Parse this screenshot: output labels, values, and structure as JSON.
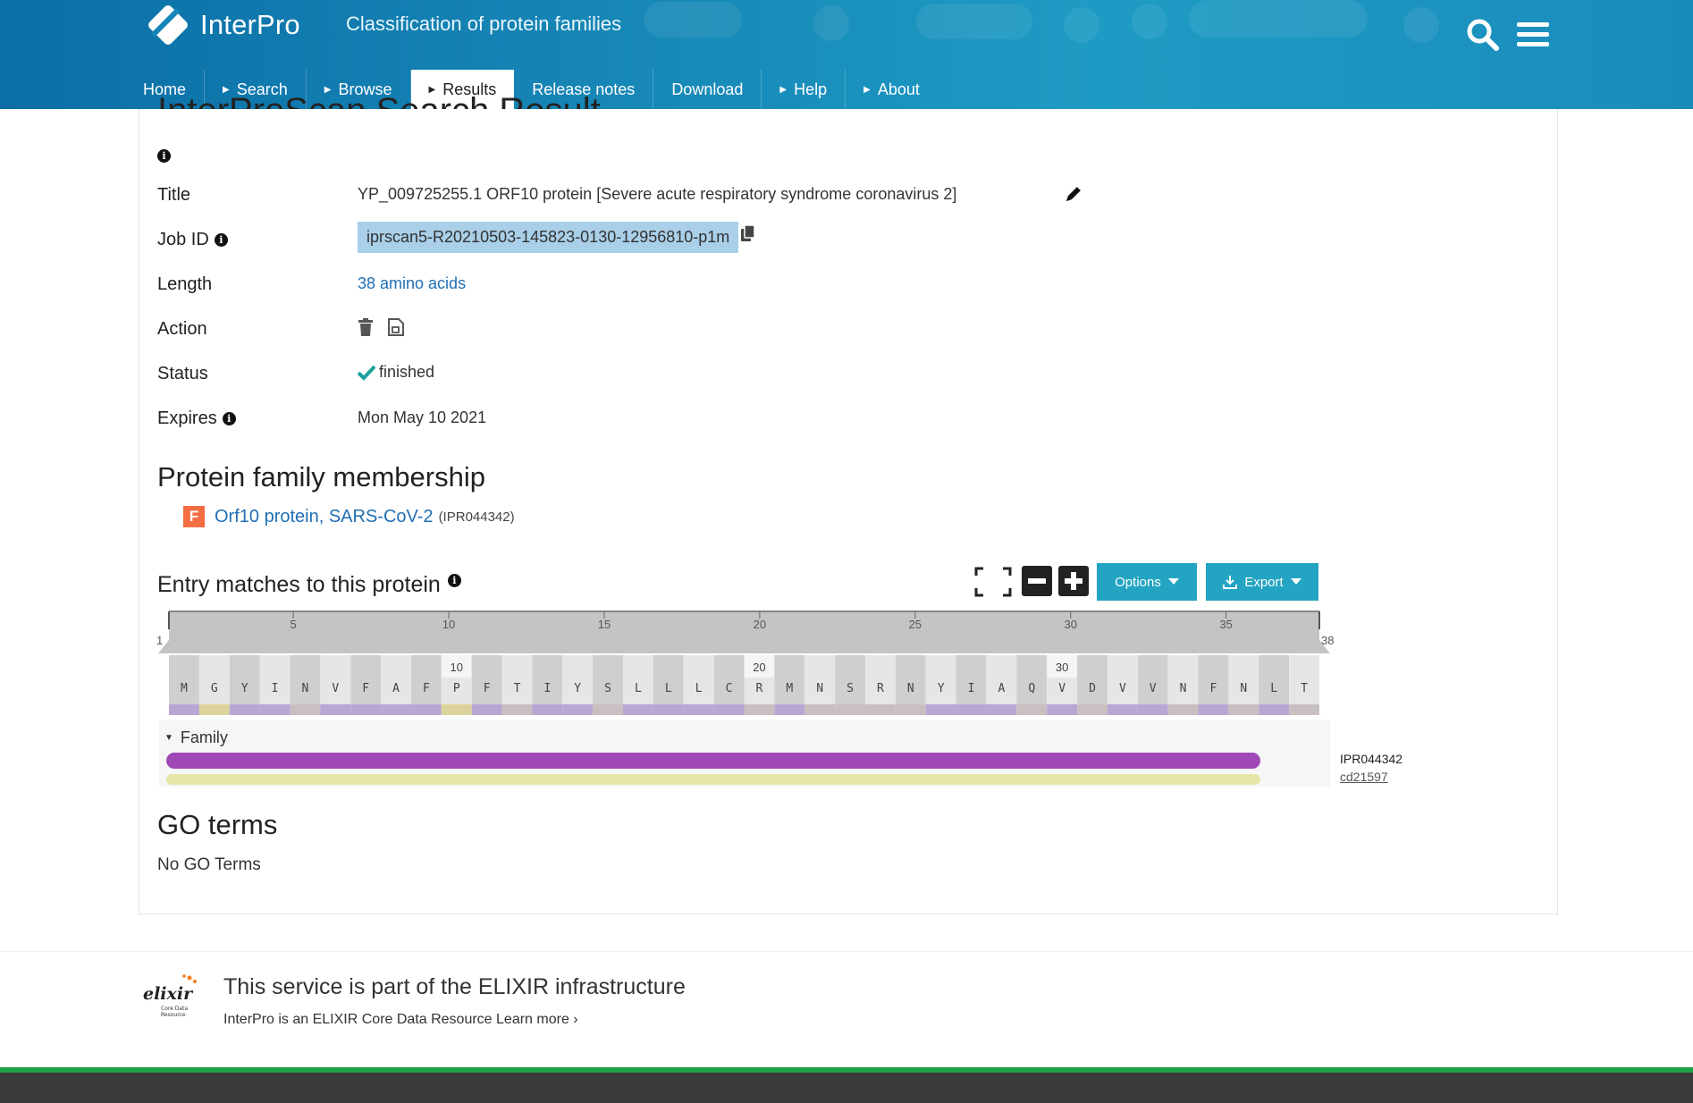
{
  "header": {
    "logo_text": "InterPro",
    "tagline": "Classification of protein families",
    "nav": [
      {
        "label": "Home",
        "arrow": false
      },
      {
        "label": "Search",
        "arrow": true
      },
      {
        "label": "Browse",
        "arrow": true
      },
      {
        "label": "Results",
        "arrow": true,
        "active": true
      },
      {
        "label": "Release notes",
        "arrow": false
      },
      {
        "label": "Download",
        "arrow": false
      },
      {
        "label": "Help",
        "arrow": true
      },
      {
        "label": "About",
        "arrow": true
      }
    ]
  },
  "page": {
    "title": "InterProScan Search Result"
  },
  "details": {
    "title_label": "Title",
    "title_value": "YP_009725255.1 ORF10 protein [Severe acute respiratory syndrome coronavirus 2]",
    "jobid_label": "Job ID",
    "jobid_value": "iprscan5-R20210503-145823-0130-12956810-p1m",
    "length_label": "Length",
    "length_value": "38 amino acids",
    "action_label": "Action",
    "status_label": "Status",
    "status_value": "finished",
    "expires_label": "Expires",
    "expires_value": "Mon May 10 2021"
  },
  "family_membership": {
    "heading": "Protein family membership",
    "badge": "F",
    "name": "Orf10 protein, SARS-CoV-2",
    "accession": "(IPR044342)"
  },
  "entry_matches": {
    "heading": "Entry matches to this protein",
    "options_label": "Options",
    "export_label": "Export",
    "ruler": {
      "start": "1",
      "end": "38",
      "ticks": [
        "5",
        "10",
        "15",
        "20",
        "25",
        "30",
        "35"
      ]
    },
    "sequence": [
      "M",
      "G",
      "Y",
      "I",
      "N",
      "V",
      "F",
      "A",
      "F",
      "P",
      "F",
      "T",
      "I",
      "Y",
      "S",
      "L",
      "L",
      "L",
      "C",
      "R",
      "M",
      "N",
      "S",
      "R",
      "N",
      "Y",
      "I",
      "A",
      "Q",
      "V",
      "D",
      "V",
      "V",
      "N",
      "F",
      "N",
      "L",
      "T"
    ],
    "sequence_marks": {
      "10": "10",
      "20": "20",
      "30": "30"
    },
    "track_label": "Family",
    "match_accessions": [
      "IPR044342",
      "cd21597"
    ]
  },
  "go_terms": {
    "heading": "GO terms",
    "empty_text": "No GO Terms"
  },
  "footer": {
    "elixir_logo_text": "elixir",
    "elixir_logo_sub1": "Core Data",
    "elixir_logo_sub2": "Resource",
    "heading": "This service is part of the ELIXIR infrastructure",
    "subtext": "InterPro is an ELIXIR Core Data Resource Learn more ›"
  },
  "colors": {
    "header_bg": "#1686b6",
    "link": "#1f6fb5",
    "button_bg": "#23a4c2",
    "interpro_family_track": "#a048b8",
    "cdd_track": "#e6e6a8",
    "family_badge": "#f46d43",
    "jobid_highlight": "#a9cfe9",
    "status_check": "#1aa39a"
  }
}
